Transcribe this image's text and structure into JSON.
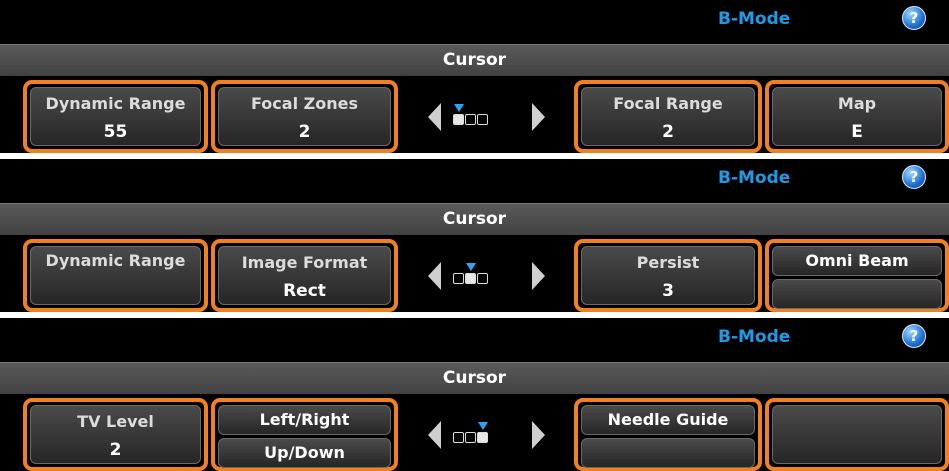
{
  "colors": {
    "accent_orange": "#f08020",
    "mode_blue": "#1e9be6",
    "page_marker": "#2aa4f0"
  },
  "panels": [
    {
      "mode_label": "B-Mode",
      "help_icon": "?",
      "cursor_label": "Cursor",
      "dynamic_range": {
        "label": "Dynamic Range",
        "value": "55"
      },
      "focal_zones": {
        "label": "Focal Zones",
        "value": "2"
      },
      "page": {
        "current": 1,
        "total": 3
      },
      "focal_range": {
        "label": "Focal Range",
        "value": "2"
      },
      "map": {
        "label": "Map",
        "value": "E"
      }
    },
    {
      "mode_label": "B-Mode",
      "help_icon": "?",
      "cursor_label": "Cursor",
      "dynamic_range": {
        "label": "Dynamic Range"
      },
      "image_format": {
        "label": "Image Format",
        "value": "Rect"
      },
      "page": {
        "current": 2,
        "total": 3
      },
      "persist": {
        "label": "Persist",
        "value": "3"
      },
      "omni_beam": {
        "label": "Omni Beam"
      }
    },
    {
      "mode_label": "B-Mode",
      "help_icon": "?",
      "cursor_label": "Cursor",
      "tv_level": {
        "label": "TV Level",
        "value": "2"
      },
      "left_right": {
        "label": "Left/Right"
      },
      "up_down": {
        "label": "Up/Down"
      },
      "page": {
        "current": 3,
        "total": 3
      },
      "needle_guide": {
        "label": "Needle Guide"
      }
    }
  ]
}
